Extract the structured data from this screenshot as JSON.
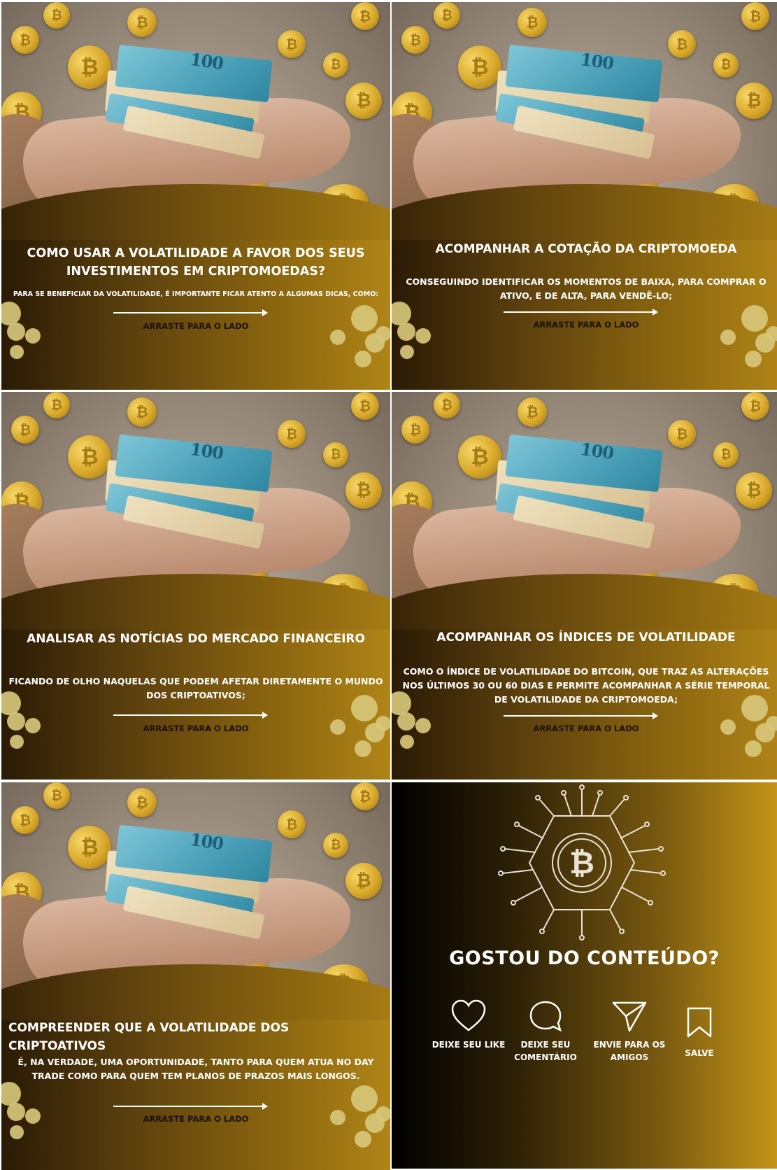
{
  "slides": [
    {
      "title": "COMO USAR A VOLATILIDADE A FAVOR DOS SEUS INVESTIMENTOS EM CRIPTOMOEDAS?",
      "desc": "PARA SE BENEFICIAR DA VOLATILIDADE, É IMPORTANTE FICAR ATENTO A ALGUMAS DICAS, COMO:",
      "swipe": "ARRASTE PARA O LADO"
    },
    {
      "title": "ACOMPANHAR A COTAÇÃO DA CRIPTOMOEDA",
      "desc": "CONSEGUINDO IDENTIFICAR OS MOMENTOS DE BAIXA, PARA COMPRAR O ATIVO, E DE ALTA, PARA VENDÊ-LO;",
      "swipe": "ARRASTE PARA O LADO"
    },
    {
      "title": "ANALISAR AS NOTÍCIAS DO MERCADO FINANCEIRO",
      "desc": "FICANDO DE OLHO NAQUELAS QUE PODEM AFETAR DIRETAMENTE O MUNDO DOS CRIPTOATIVOS;",
      "swipe": "ARRASTE PARA O LADO"
    },
    {
      "title": "ACOMPANHAR OS ÍNDICES DE VOLATILIDADE",
      "desc": "COMO O ÍNDICE DE VOLATILIDADE DO BITCOIN, QUE TRAZ AS ALTERAÇÕES NOS ÚLTIMOS 30 OU 60 DIAS E PERMITE ACOMPANHAR A SÉRIE TEMPORAL DE VOLATILIDADE DA CRIPTOMOEDA;",
      "swipe": "ARRASTE PARA O LADO"
    },
    {
      "title": "COMPREENDER QUE A VOLATILIDADE DOS CRIPTOATIVOS",
      "desc": "É, NA VERDADE, UMA OPORTUNIDADE, TANTO PARA QUEM ATUA NO DAY TRADE COMO PARA QUEM TEM PLANOS DE PRAZOS MAIS LONGOS.",
      "swipe": "ARRASTE PARA O LADO"
    }
  ],
  "bill_value": "100",
  "final": {
    "title": "GOSTOU DO CONTEÚDO?",
    "actions": [
      {
        "icon": "heart-icon",
        "label": "DEIXE SEU LIKE"
      },
      {
        "icon": "comment-icon",
        "label": "DEIXE SEU COMENTÁRIO"
      },
      {
        "icon": "send-icon",
        "label": "ENVIE PARA OS AMIGOS"
      },
      {
        "icon": "bookmark-icon",
        "label": "SALVE"
      }
    ]
  },
  "colors": {
    "gold": "#c39417",
    "band_dark": "#2a1a05",
    "blob": "#d7c57a"
  }
}
